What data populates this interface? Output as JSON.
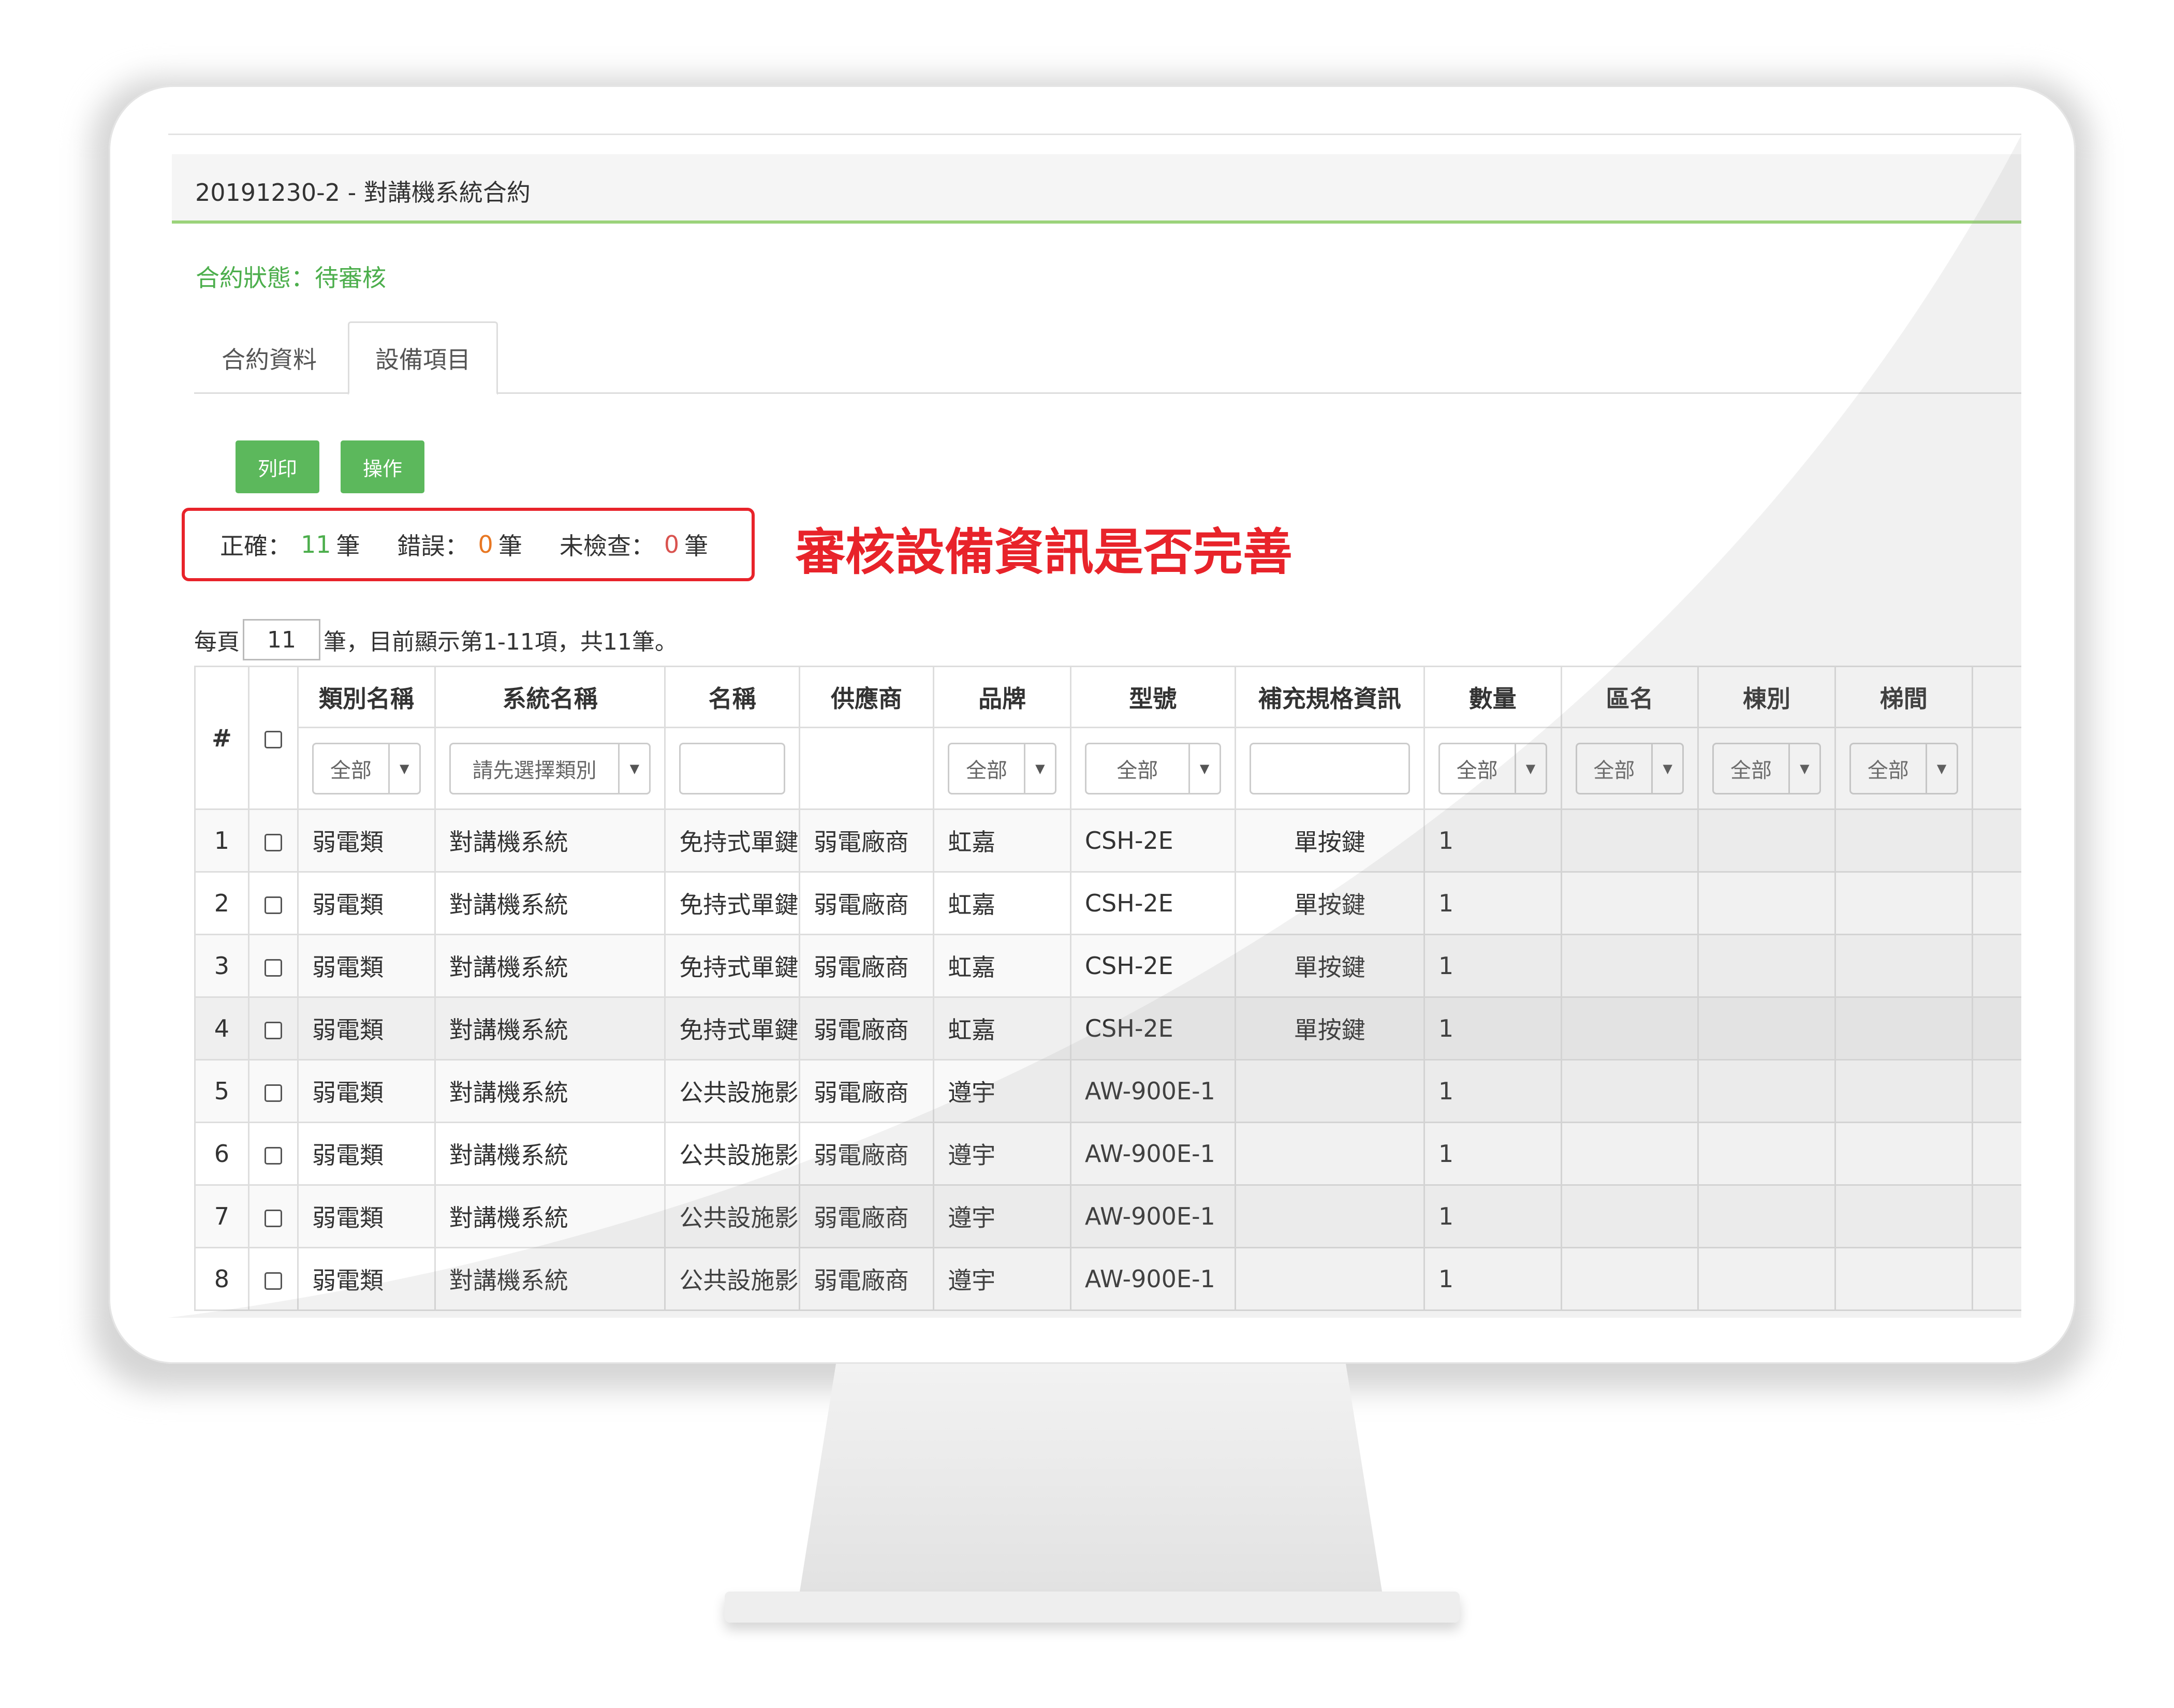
{
  "header": {
    "title": "20191230-2 - 對講機系統合約"
  },
  "status_text": "合約狀態：待審核",
  "tabs": [
    {
      "label": "合約資料"
    },
    {
      "label": "設備項目"
    }
  ],
  "buttons": {
    "print": "列印",
    "operate": "操作"
  },
  "summary": {
    "correct_label": "正確：",
    "correct_count": "11",
    "correct_unit": "筆",
    "error_label": "錯誤：",
    "error_count": "0",
    "error_unit": "筆",
    "unchecked_label": "未檢查：",
    "unchecked_count": "0",
    "unchecked_unit": "筆"
  },
  "annotation": "審核設備資訊是否完善",
  "pagination": {
    "prefix": "每頁",
    "per_page": "11",
    "suffix": "筆，目前顯示第1-11項，共11筆。"
  },
  "table": {
    "headers": [
      "#",
      "類別名稱",
      "系統名稱",
      "名稱",
      "供應商",
      "品牌",
      "型號",
      "補充規格資訊",
      "數量",
      "區名",
      "棟別",
      "梯間"
    ],
    "filters": {
      "category": "全部",
      "system": "請先選擇類別",
      "brand": "全部",
      "model": "全部",
      "quantity": "全部",
      "area": "全部",
      "building": "全部",
      "stair": "全部"
    },
    "rows": [
      [
        "1",
        "弱電類",
        "對講機系統",
        "免持式單鍵對講機",
        "弱電廠商",
        "虹嘉",
        "CSH-2E",
        "單按鍵",
        "1",
        "",
        "",
        ""
      ],
      [
        "2",
        "弱電類",
        "對講機系統",
        "免持式單鍵對講機",
        "弱電廠商",
        "虹嘉",
        "CSH-2E",
        "單按鍵",
        "1",
        "",
        "",
        ""
      ],
      [
        "3",
        "弱電類",
        "對講機系統",
        "免持式單鍵對講機",
        "弱電廠商",
        "虹嘉",
        "CSH-2E",
        "單按鍵",
        "1",
        "",
        "",
        ""
      ],
      [
        "4",
        "弱電類",
        "對講機系統",
        "免持式單鍵對講機",
        "弱電廠商",
        "虹嘉",
        "CSH-2E",
        "單按鍵",
        "1",
        "",
        "",
        ""
      ],
      [
        "5",
        "弱電類",
        "對講機系統",
        "公共設施影像對講機",
        "弱電廠商",
        "遵宇",
        "AW-900E-1",
        "",
        "1",
        "",
        "",
        ""
      ],
      [
        "6",
        "弱電類",
        "對講機系統",
        "公共設施影像對講機",
        "弱電廠商",
        "遵宇",
        "AW-900E-1",
        "",
        "1",
        "",
        "",
        ""
      ],
      [
        "7",
        "弱電類",
        "對講機系統",
        "公共設施影像對講機",
        "弱電廠商",
        "遵宇",
        "AW-900E-1",
        "",
        "1",
        "",
        "",
        ""
      ],
      [
        "8",
        "弱電類",
        "對講機系統",
        "公共設施影像對講機",
        "弱電廠商",
        "遵宇",
        "AW-900E-1",
        "",
        "1",
        "",
        "",
        ""
      ]
    ]
  },
  "colors": {
    "accent_green": "#5cb85c",
    "status_green": "#4cae4c",
    "annotation_red": "#e8232a",
    "header_underline": "#9bd37b"
  }
}
